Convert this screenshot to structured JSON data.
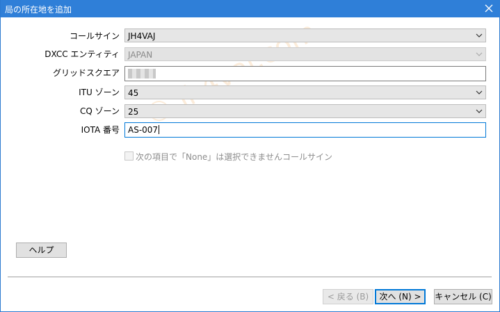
{
  "window": {
    "title": "局の所在地を追加"
  },
  "form": {
    "callsign_label": "コールサイン",
    "callsign_value": "JH4VAJ",
    "dxcc_label": "DXCC エンティティ",
    "dxcc_value": "JAPAN",
    "grid_label": "グリッドスクエア",
    "itu_label": "ITU ゾーン",
    "itu_value": "45",
    "cq_label": "CQ ゾーン",
    "cq_value": "25",
    "iota_label": "IOTA 番号",
    "iota_value": "AS-007",
    "checkbox_label": "次の項目で「None」は選択できませんコールサイン"
  },
  "buttons": {
    "help": "ヘルプ",
    "back": "< 戻る (B)",
    "next": "次へ (N) >",
    "cancel": "キャンセル (C)"
  },
  "watermark": "© jh4vaj.com",
  "icons": {
    "close": "close-icon",
    "chevron": "chevron-down-icon"
  },
  "colors": {
    "titlebar": "#2f7fd8",
    "focus": "#0078d7"
  }
}
